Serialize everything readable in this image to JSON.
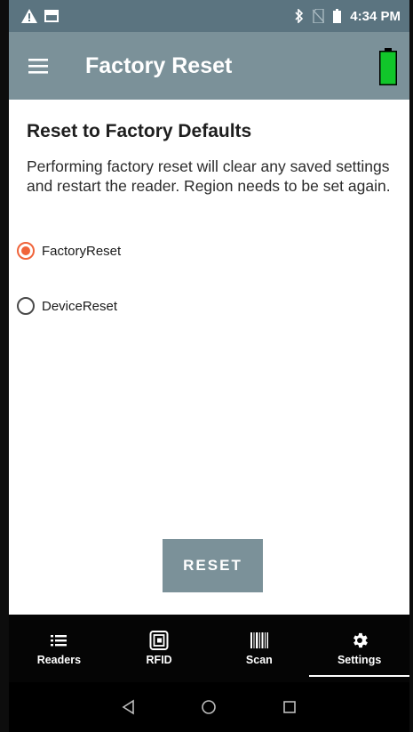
{
  "status_bar": {
    "time": "4:34 PM",
    "icons": [
      "warning-icon",
      "image-icon",
      "bluetooth-icon",
      "no-sim-icon",
      "battery-icon"
    ]
  },
  "app_bar": {
    "title": "Factory Reset",
    "menu_icon": "menu-icon",
    "battery_icon": "reader-battery-icon",
    "battery_color": "#11c62a"
  },
  "content": {
    "heading": "Reset to Factory Defaults",
    "description": "Performing factory reset will clear any saved settings and restart the reader. Region needs to be set again.",
    "options": [
      {
        "label": "FactoryReset",
        "selected": true
      },
      {
        "label": "DeviceReset",
        "selected": false
      }
    ],
    "reset_button": "RESET"
  },
  "bottom_nav": {
    "items": [
      {
        "label": "Readers",
        "icon": "list-icon"
      },
      {
        "label": "RFID",
        "icon": "rfid-icon"
      },
      {
        "label": "Scan",
        "icon": "barcode-icon"
      },
      {
        "label": "Settings",
        "icon": "gear-icon",
        "active": true
      }
    ]
  },
  "system_nav": {
    "icons": [
      "back-icon",
      "home-icon",
      "recents-icon"
    ]
  },
  "colors": {
    "primary": "#7b9199",
    "status_bar": "#5b7480",
    "accent": "#f0643a"
  }
}
